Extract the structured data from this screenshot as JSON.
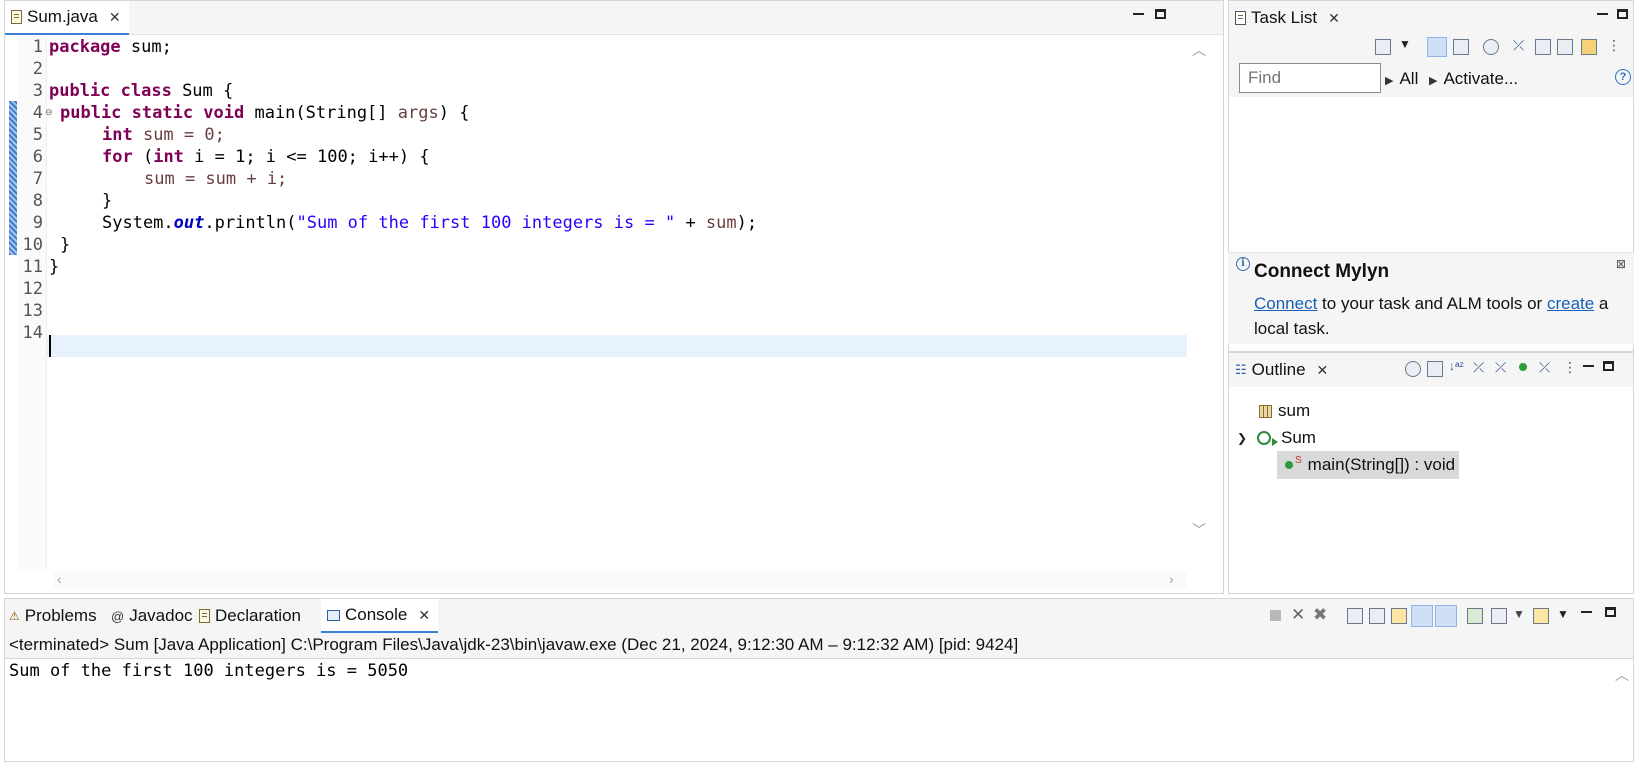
{
  "editor": {
    "tab_label": "Sum.java",
    "line_numbers": [
      "1",
      "2",
      "3",
      "4",
      "5",
      "6",
      "7",
      "8",
      "9",
      "10",
      "11",
      "12",
      "13",
      "14"
    ],
    "code": {
      "l1_kw": "package",
      "l1_rest": " sum;",
      "l3_kw": "public class",
      "l3_rest": " Sum {",
      "l4_kw": "public static void",
      "l4_a": " main(String[] ",
      "l4_var": "args",
      "l4_b": ") {",
      "l5_kw": "int",
      "l5_rest": " sum = 0;",
      "l6_kw": "for",
      "l6_a": " (",
      "l6_kw2": "int",
      "l6_b": " i = 1; i <= 100; i++) {",
      "l7": "sum = sum + i;",
      "l8": "}",
      "l9_a": "System.",
      "l9_fld": "out",
      "l9_b": ".println(",
      "l9_str": "\"Sum of the first 100 integers is = \"",
      "l9_c": " + ",
      "l9_var": "sum",
      "l9_d": ");",
      "l10": "}",
      "l11": "}"
    }
  },
  "tasklist": {
    "tab_label": "Task List",
    "find_placeholder": "Find",
    "all_label": "All",
    "activate_label": "Activate..."
  },
  "mylyn": {
    "title": "Connect Mylyn",
    "connect_link": "Connect",
    "text_middle": " to your task and ALM tools or ",
    "create_link": "create",
    "text_end": " a local task."
  },
  "outline": {
    "tab_label": "Outline",
    "items": [
      {
        "label": "sum",
        "icon": "package-icon"
      },
      {
        "label": "Sum",
        "icon": "class-icon"
      },
      {
        "label": "main(String[]) : void",
        "icon": "method-icon"
      }
    ]
  },
  "console": {
    "tabs": [
      {
        "label": "Problems",
        "icon": "problems-icon"
      },
      {
        "label": "Javadoc",
        "icon": "javadoc-icon"
      },
      {
        "label": "Declaration",
        "icon": "declaration-icon"
      },
      {
        "label": "Console",
        "icon": "console-icon"
      }
    ],
    "description": "<terminated> Sum [Java Application] C:\\Program Files\\Java\\jdk-23\\bin\\javaw.exe  (Dec 21, 2024, 9:12:30 AM – 9:12:32 AM) [pid: 9424]",
    "output": "Sum of the first 100 integers is = 5050"
  },
  "colors": {
    "keyword": "#7f0055",
    "string": "#2a00ff",
    "field": "#0000c0",
    "link": "#1a5fb4",
    "active_tab_underline": "#3d7fd6"
  }
}
